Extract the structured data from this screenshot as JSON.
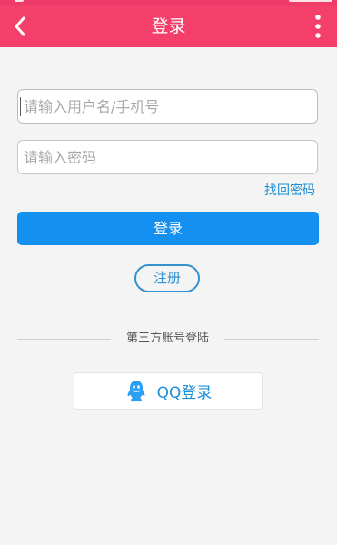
{
  "header": {
    "title": "登录",
    "back_icon": "back-arrow-icon",
    "more_icon": "more-vert-icon"
  },
  "form": {
    "username_placeholder": "请输入用户名/手机号",
    "password_placeholder": "请输入密码",
    "forgot_label": "找回密码",
    "login_label": "登录",
    "register_label": "注册"
  },
  "third_party": {
    "divider_text": "第三方账号登陆",
    "qq_label": "QQ登录",
    "qq_icon": "qq-penguin-icon"
  },
  "colors": {
    "header": "#f53f6b",
    "primary": "#1491f0",
    "link": "#1d8fd6"
  }
}
